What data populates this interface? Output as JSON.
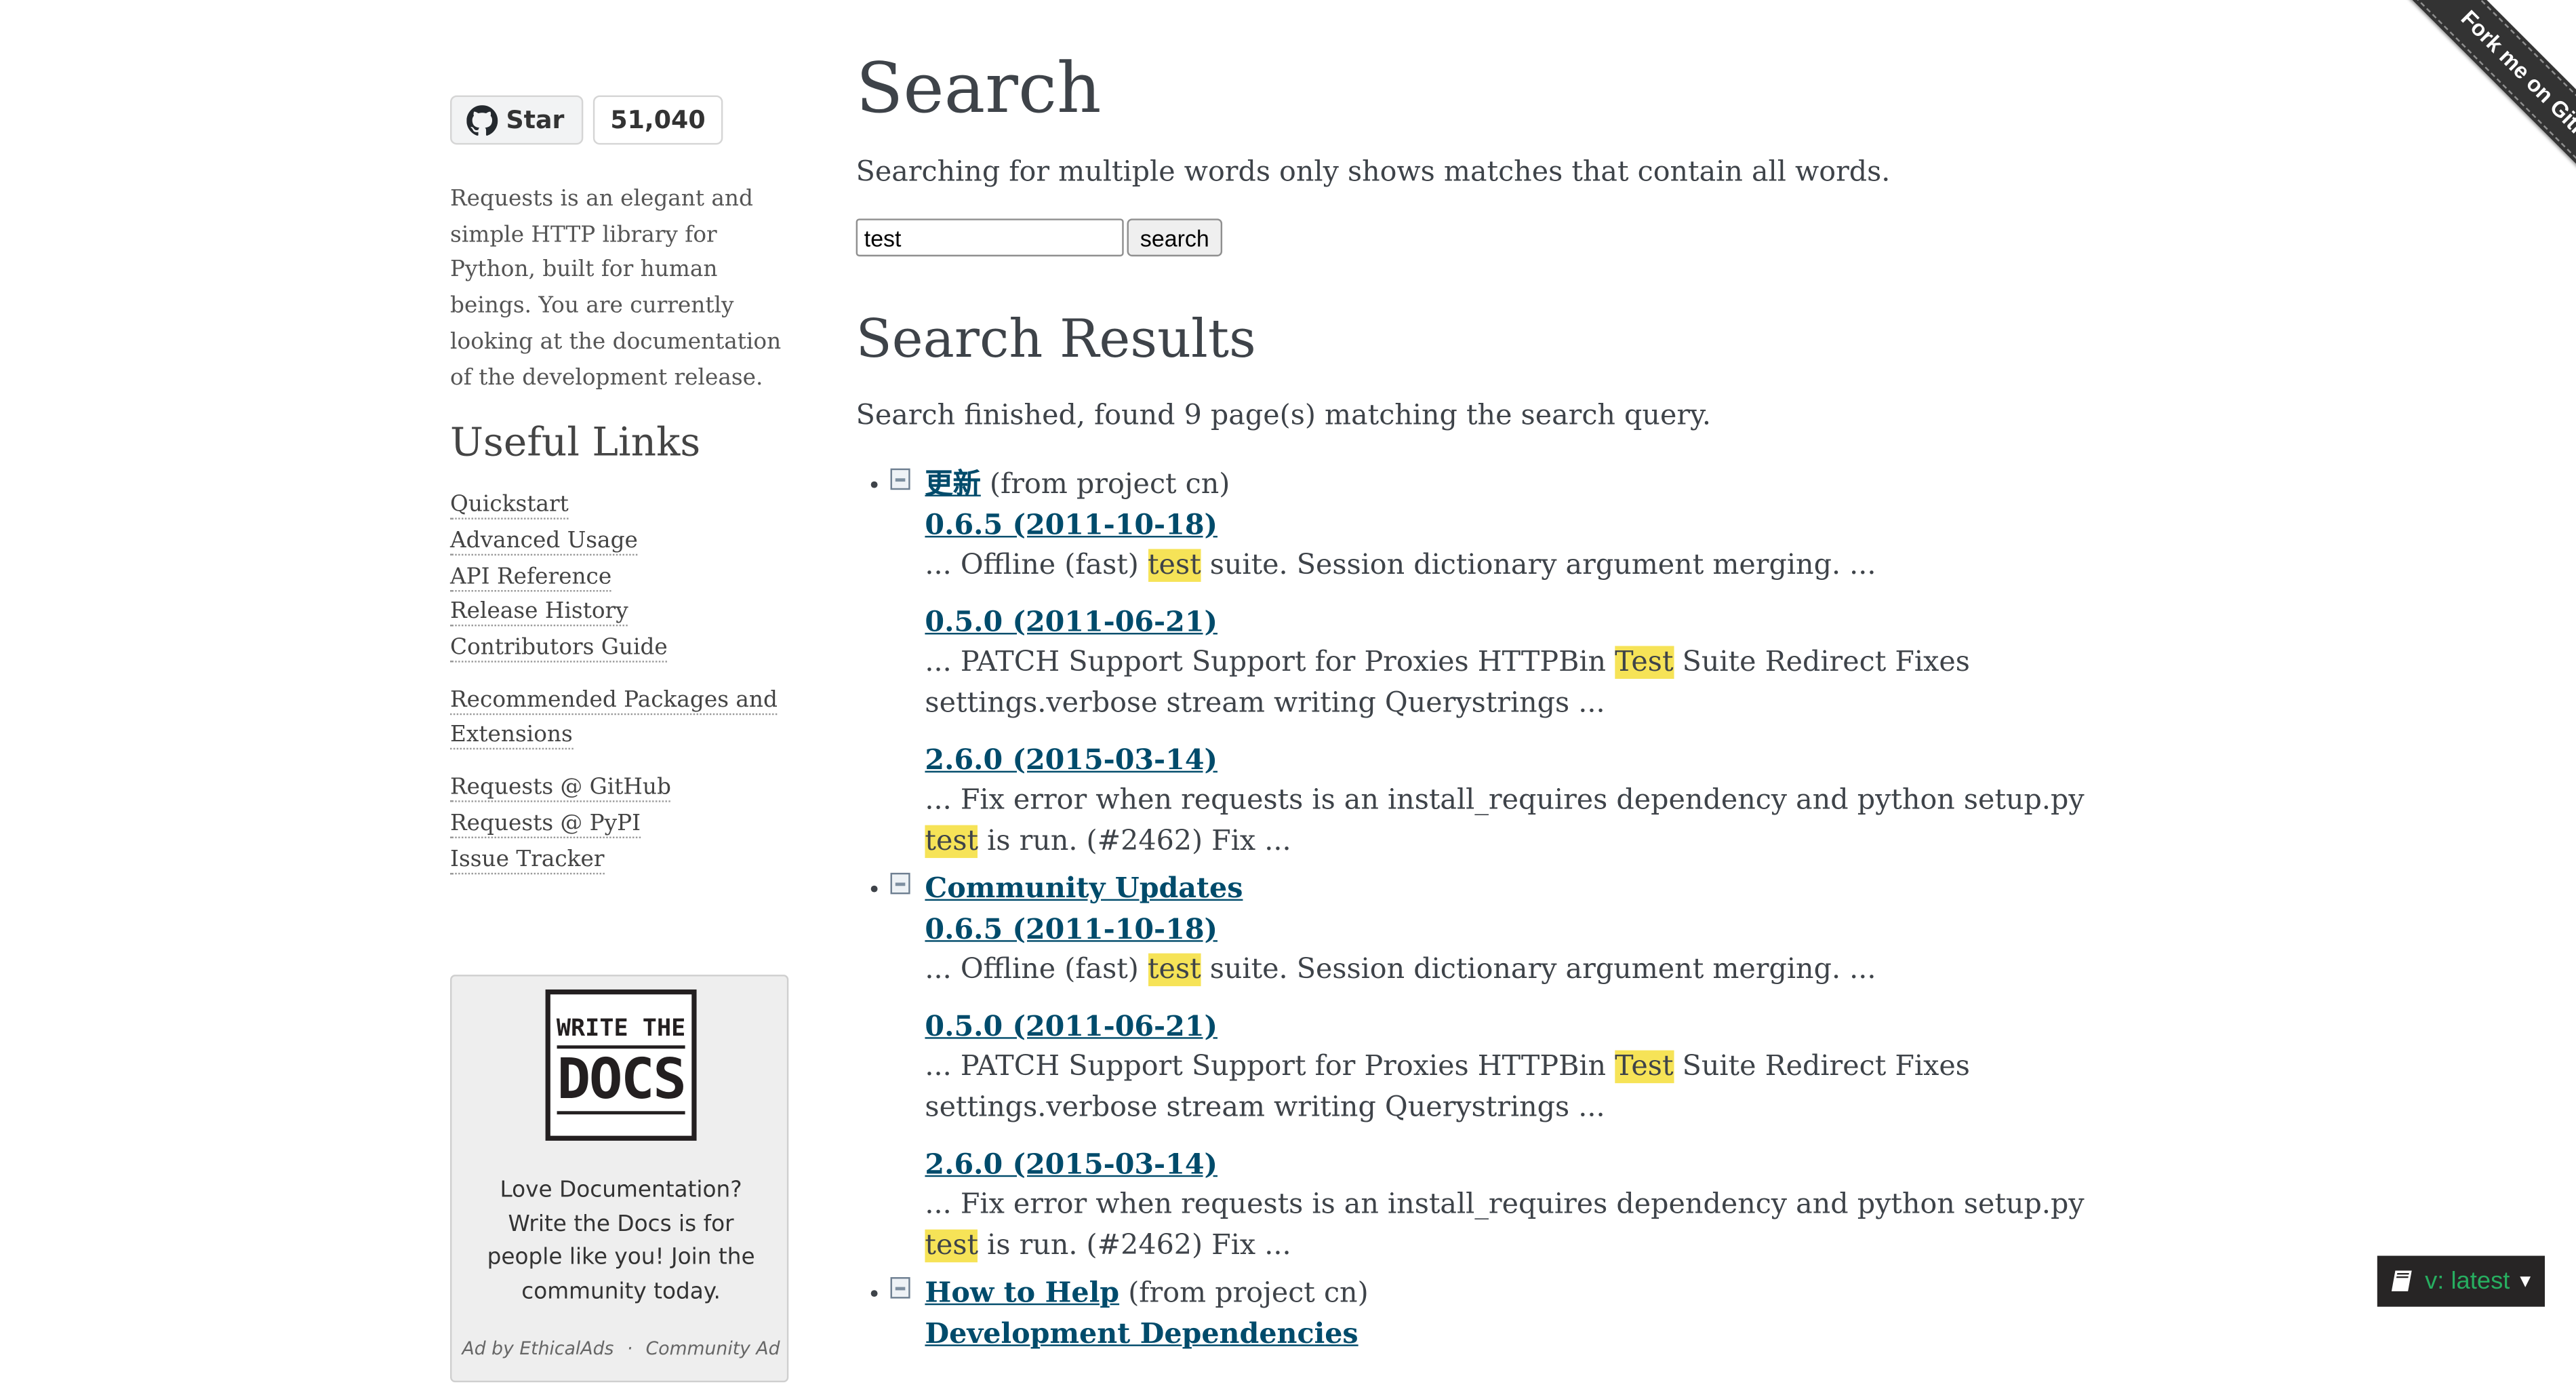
{
  "github": {
    "star_label": "Star",
    "star_count": "51,040"
  },
  "sidebar": {
    "about": "Requests is an elegant and simple HTTP library for Python, built for human beings. You are currently looking at the documentation of the development release.",
    "useful_links_title": "Useful Links",
    "links_group1": [
      "Quickstart",
      "Advanced Usage",
      "API Reference",
      "Release History",
      "Contributors Guide"
    ],
    "links_group2": [
      "Recommended Packages and Extensions"
    ],
    "links_group3": [
      "Requests @ GitHub",
      "Requests @ PyPI",
      "Issue Tracker"
    ]
  },
  "ad": {
    "logo_line1": "WRITE THE",
    "logo_line2": "DOCS",
    "text": "Love Documentation? Write the Docs is for people like you! Join the community today.",
    "footer_left": "Ad by EthicalAds",
    "footer_sep": "·",
    "footer_right": "Community Ad"
  },
  "main": {
    "title": "Search",
    "intro": "Searching for multiple words only shows matches that contain all words.",
    "search_value": "test",
    "search_button": "search",
    "results_title": "Search Results",
    "status": "Search finished, found 9 page(s) matching the search query."
  },
  "results": [
    {
      "title": "更新",
      "from": "(from project cn)",
      "sections": [
        {
          "title": "0.6.5 (2011-10-18)",
          "before": "... Offline (fast) ",
          "hl": "test",
          "after": " suite. Session dictionary argument merging. ..."
        },
        {
          "title": "0.5.0 (2011-06-21)",
          "before": "... PATCH Support Support for Proxies HTTPBin ",
          "hl": "Test",
          "after": " Suite Redirect Fixes settings.verbose stream writing Querystrings ..."
        },
        {
          "title": "2.6.0 (2015-03-14)",
          "before": "... Fix error when requests is an install_requires dependency and python setup.py ",
          "hl": "test",
          "after": " is run. (#2462) Fix ..."
        }
      ]
    },
    {
      "title": "Community Updates",
      "from": "",
      "sections": [
        {
          "title": "0.6.5 (2011-10-18)",
          "before": "... Offline (fast) ",
          "hl": "test",
          "after": " suite. Session dictionary argument merging. ..."
        },
        {
          "title": "0.5.0 (2011-06-21)",
          "before": "... PATCH Support Support for Proxies HTTPBin ",
          "hl": "Test",
          "after": " Suite Redirect Fixes settings.verbose stream writing Querystrings ..."
        },
        {
          "title": "2.6.0 (2015-03-14)",
          "before": "... Fix error when requests is an install_requires dependency and python setup.py ",
          "hl": "test",
          "after": " is run. (#2462) Fix ..."
        }
      ]
    },
    {
      "title": "How to Help",
      "from": "(from project cn)",
      "sections": [
        {
          "title": "Development Dependencies",
          "before": "",
          "hl": "",
          "after": ""
        }
      ]
    }
  ],
  "ribbon": {
    "label": "Fork me on GitHub"
  },
  "version": {
    "label": "v: latest"
  },
  "colors": {
    "link": "#004b6b",
    "highlight": "#f6e357",
    "version_green": "#27ae60"
  }
}
